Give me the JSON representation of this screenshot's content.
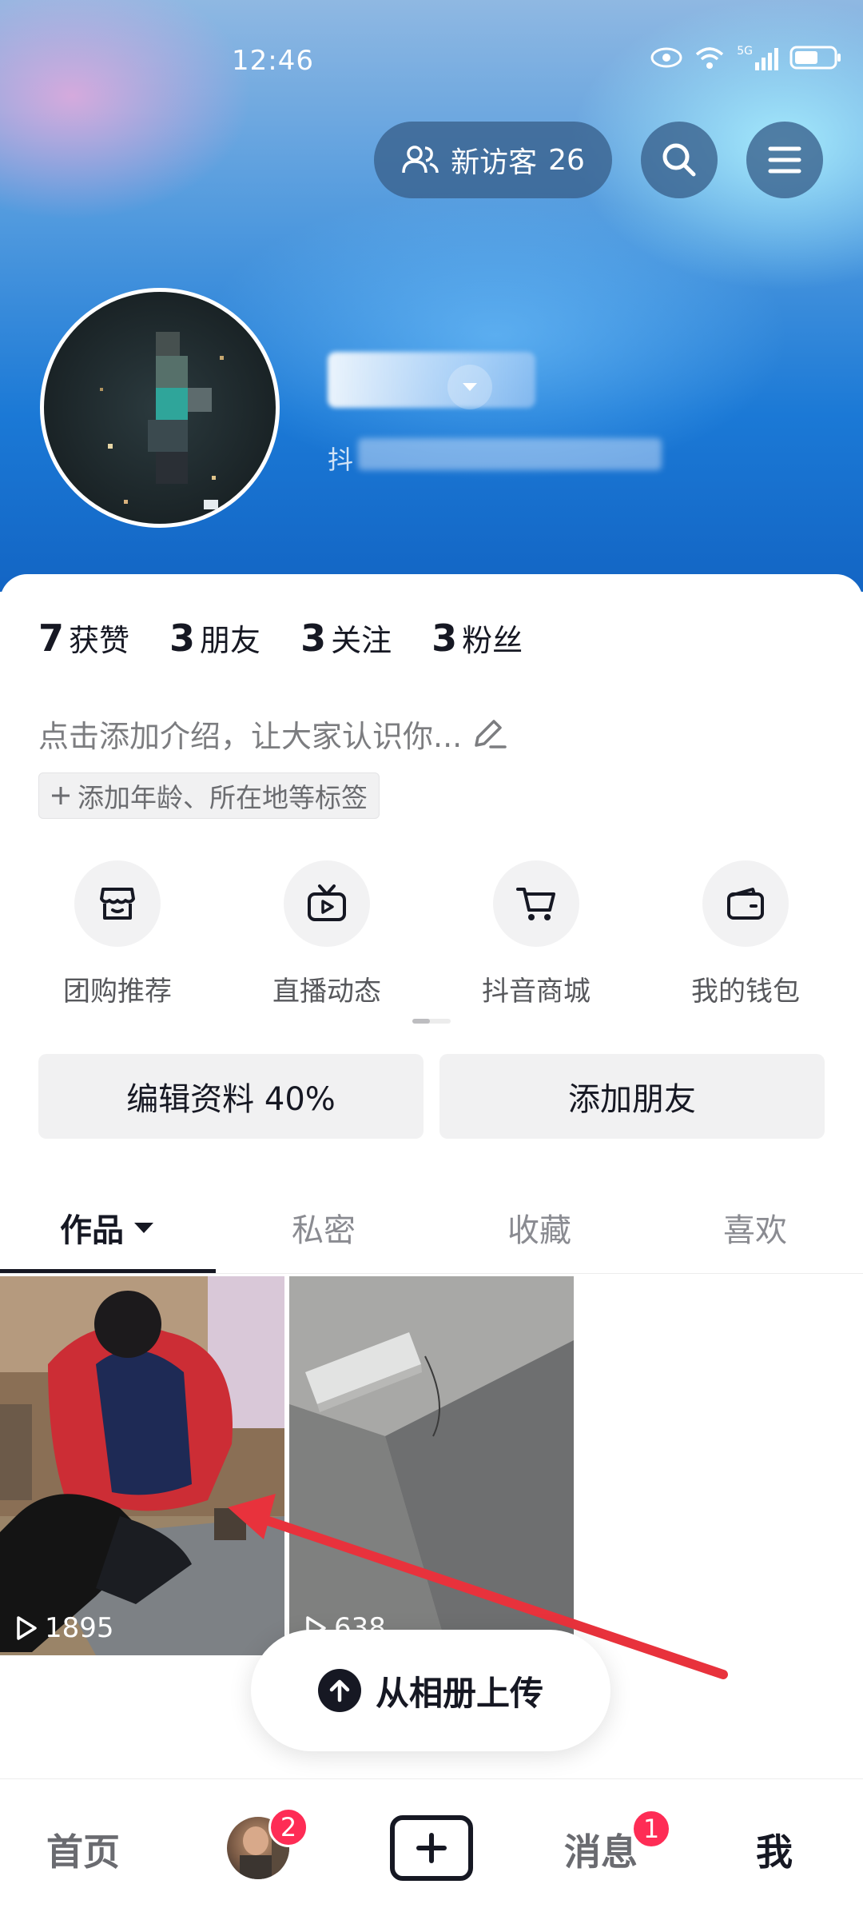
{
  "status_bar": {
    "time": "12:46",
    "network": "5G"
  },
  "header": {
    "visitor_label": "新访客",
    "visitor_count": "26",
    "id_prefix": "抖"
  },
  "stats": [
    {
      "num": "7",
      "label": "获赞"
    },
    {
      "num": "3",
      "label": "朋友"
    },
    {
      "num": "3",
      "label": "关注"
    },
    {
      "num": "3",
      "label": "粉丝"
    }
  ],
  "bio": {
    "placeholder": "点击添加介绍，让大家认识你...",
    "tag_button": "添加年龄、所在地等标签"
  },
  "services": [
    {
      "label": "团购推荐",
      "icon": "shop-icon"
    },
    {
      "label": "直播动态",
      "icon": "live-tv-icon"
    },
    {
      "label": "抖音商城",
      "icon": "cart-icon"
    },
    {
      "label": "我的钱包",
      "icon": "wallet-icon"
    }
  ],
  "actions": {
    "edit_profile": "编辑资料 40%",
    "add_friend": "添加朋友"
  },
  "tabs": [
    "作品",
    "私密",
    "收藏",
    "喜欢"
  ],
  "videos": [
    {
      "plays": "1895"
    },
    {
      "plays": "638"
    }
  ],
  "upload": {
    "label": "从相册上传"
  },
  "bottom_nav": {
    "home": "首页",
    "friends_badge": "2",
    "messages": "消息",
    "messages_badge": "1",
    "me": "我"
  },
  "colors": {
    "accent": "#fe2c55",
    "text": "#161823",
    "header_blue": "#1b79d6"
  }
}
